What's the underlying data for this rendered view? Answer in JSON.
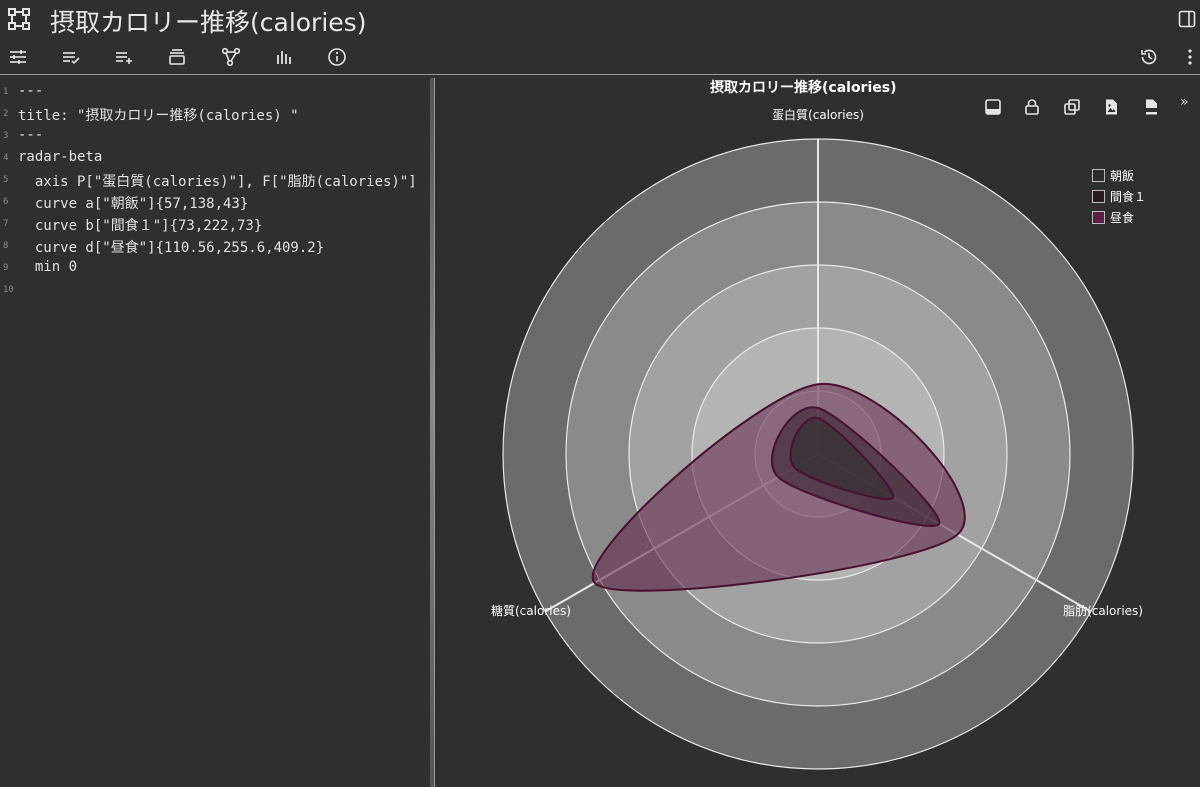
{
  "window": {
    "title": "摂取カロリー推移(calories)"
  },
  "toolbar": {
    "left_icons": [
      "sliders-icon",
      "list-check-icon",
      "list-add-icon",
      "layers-icon",
      "graph-nodes-icon",
      "bar-chart-icon",
      "info-icon"
    ],
    "right_icons": [
      "history-icon",
      "more-vertical-icon"
    ]
  },
  "editor": {
    "lines": [
      {
        "num": "1",
        "text": "---"
      },
      {
        "num": "2",
        "text": "title: \"摂取カロリー推移(calories) \""
      },
      {
        "num": "3",
        "text": "---"
      },
      {
        "num": "4",
        "text": "radar-beta"
      },
      {
        "num": "5",
        "text": "  axis P[\"蛋白質(calories)\"], F[\"脂肪(calories)\"]"
      },
      {
        "num": "6",
        "text": "  curve a[\"朝飯\"]{57,138,43}"
      },
      {
        "num": "7",
        "text": "  curve b[\"間食１\"]{73,222,73}"
      },
      {
        "num": "8",
        "text": "  curve d[\"昼食\"]{110.56,255.6,409.2}"
      },
      {
        "num": "9",
        "text": "  min 0"
      },
      {
        "num": "10",
        "text": ""
      }
    ]
  },
  "preview": {
    "icons": [
      "dock-bottom-icon",
      "lock-icon",
      "copy-icon",
      "image-file-icon",
      "png-file-icon"
    ],
    "more_label": "»"
  },
  "chart_data": {
    "type": "radar",
    "title": "摂取カロリー推移(calories)",
    "axes": [
      "蛋白質(calories)",
      "脂肪(calories)",
      "糖質(calories)"
    ],
    "min": 0,
    "max": 500,
    "rings": 5,
    "series": [
      {
        "name": "朝飯",
        "values": [
          57,
          138,
          43
        ],
        "color": "#2b2b2b"
      },
      {
        "name": "間食１",
        "values": [
          73,
          222,
          73
        ],
        "color": "#2a1a24"
      },
      {
        "name": "昼食",
        "values": [
          110.56,
          255.6,
          409.2
        ],
        "color": "#5c1f47"
      }
    ],
    "legend": "top-right",
    "curve": "smooth"
  },
  "colors": {
    "background": "#2f2f2f",
    "series_stroke": "#4a0f33",
    "series_fill": "#6b2a54"
  }
}
